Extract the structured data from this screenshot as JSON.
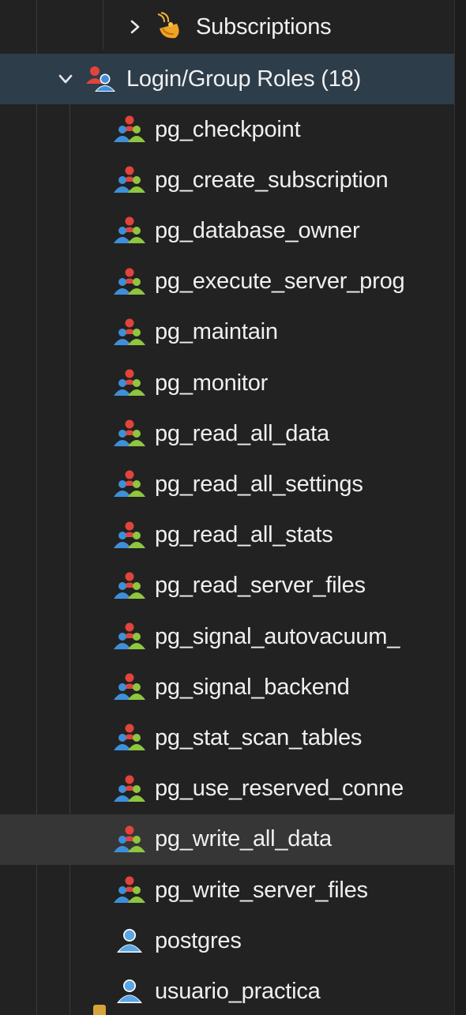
{
  "tree": {
    "subscriptions": {
      "label": "Subscriptions",
      "icon": "subscriptions-icon"
    },
    "roles_group": {
      "label": "Login/Group Roles (18)",
      "icon": "group-roles-icon"
    },
    "roles": [
      {
        "label": "pg_checkpoint",
        "icon": "group-role-icon"
      },
      {
        "label": "pg_create_subscription",
        "icon": "group-role-icon"
      },
      {
        "label": "pg_database_owner",
        "icon": "group-role-icon"
      },
      {
        "label": "pg_execute_server_prog",
        "icon": "group-role-icon"
      },
      {
        "label": "pg_maintain",
        "icon": "group-role-icon"
      },
      {
        "label": "pg_monitor",
        "icon": "group-role-icon"
      },
      {
        "label": "pg_read_all_data",
        "icon": "group-role-icon"
      },
      {
        "label": "pg_read_all_settings",
        "icon": "group-role-icon"
      },
      {
        "label": "pg_read_all_stats",
        "icon": "group-role-icon"
      },
      {
        "label": "pg_read_server_files",
        "icon": "group-role-icon"
      },
      {
        "label": "pg_signal_autovacuum_",
        "icon": "group-role-icon"
      },
      {
        "label": "pg_signal_backend",
        "icon": "group-role-icon"
      },
      {
        "label": "pg_stat_scan_tables",
        "icon": "group-role-icon"
      },
      {
        "label": "pg_use_reserved_conne",
        "icon": "group-role-icon"
      },
      {
        "label": "pg_write_all_data",
        "icon": "group-role-icon"
      },
      {
        "label": "pg_write_server_files",
        "icon": "group-role-icon"
      },
      {
        "label": "postgres",
        "icon": "login-role-icon"
      },
      {
        "label": "usuario_practica",
        "icon": "login-role-icon"
      }
    ]
  },
  "colors": {
    "background": "#222222",
    "text": "#f0f0f0",
    "selected_row": "#2e3d4a",
    "hover_row": "#363636",
    "role_red": "#e0443c",
    "role_blue": "#3f8fd8",
    "role_green": "#8ec63f",
    "login_blue": "#5aa6e6"
  }
}
